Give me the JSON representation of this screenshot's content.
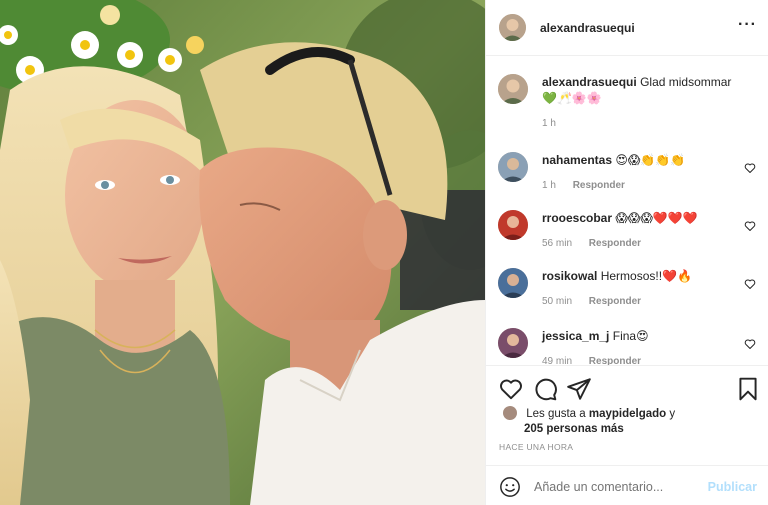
{
  "post": {
    "author": "alexandrasuequi",
    "more_icon": "more-icon",
    "caption": {
      "username": "alexandrasuequi",
      "text": "Glad midsommar 💚🥂🌸🌸",
      "time": "1 h"
    },
    "comments": [
      {
        "username": "nahamentas",
        "text": "😍😱👏👏👏",
        "time": "1 h",
        "reply": "Responder",
        "avatar_color": "#8aa0b5"
      },
      {
        "username": "rrooescobar",
        "text": "😱😱😱❤️❤️❤️",
        "time": "56 min",
        "reply": "Responder",
        "avatar_color": "#c0392b"
      },
      {
        "username": "rosikowal",
        "text": "Hermosos!!❤️🔥",
        "time": "50 min",
        "reply": "Responder",
        "avatar_color": "#4a6f9a"
      },
      {
        "username": "jessica_m_j",
        "text": "Fina😍",
        "time": "49 min",
        "reply": "Responder",
        "avatar_color": "#7a4d6a"
      }
    ],
    "likes": {
      "prefix": "Les gusta a",
      "user": "maypidelgado",
      "suffix": "y",
      "others": "205 personas más"
    },
    "timestamp": "HACE UNA HORA",
    "add_comment": {
      "placeholder": "Añade un comentario...",
      "post_label": "Publicar"
    }
  },
  "colors": {
    "link_disabled": "#b2dffc",
    "muted": "#8e8e8e",
    "text": "#262626"
  }
}
